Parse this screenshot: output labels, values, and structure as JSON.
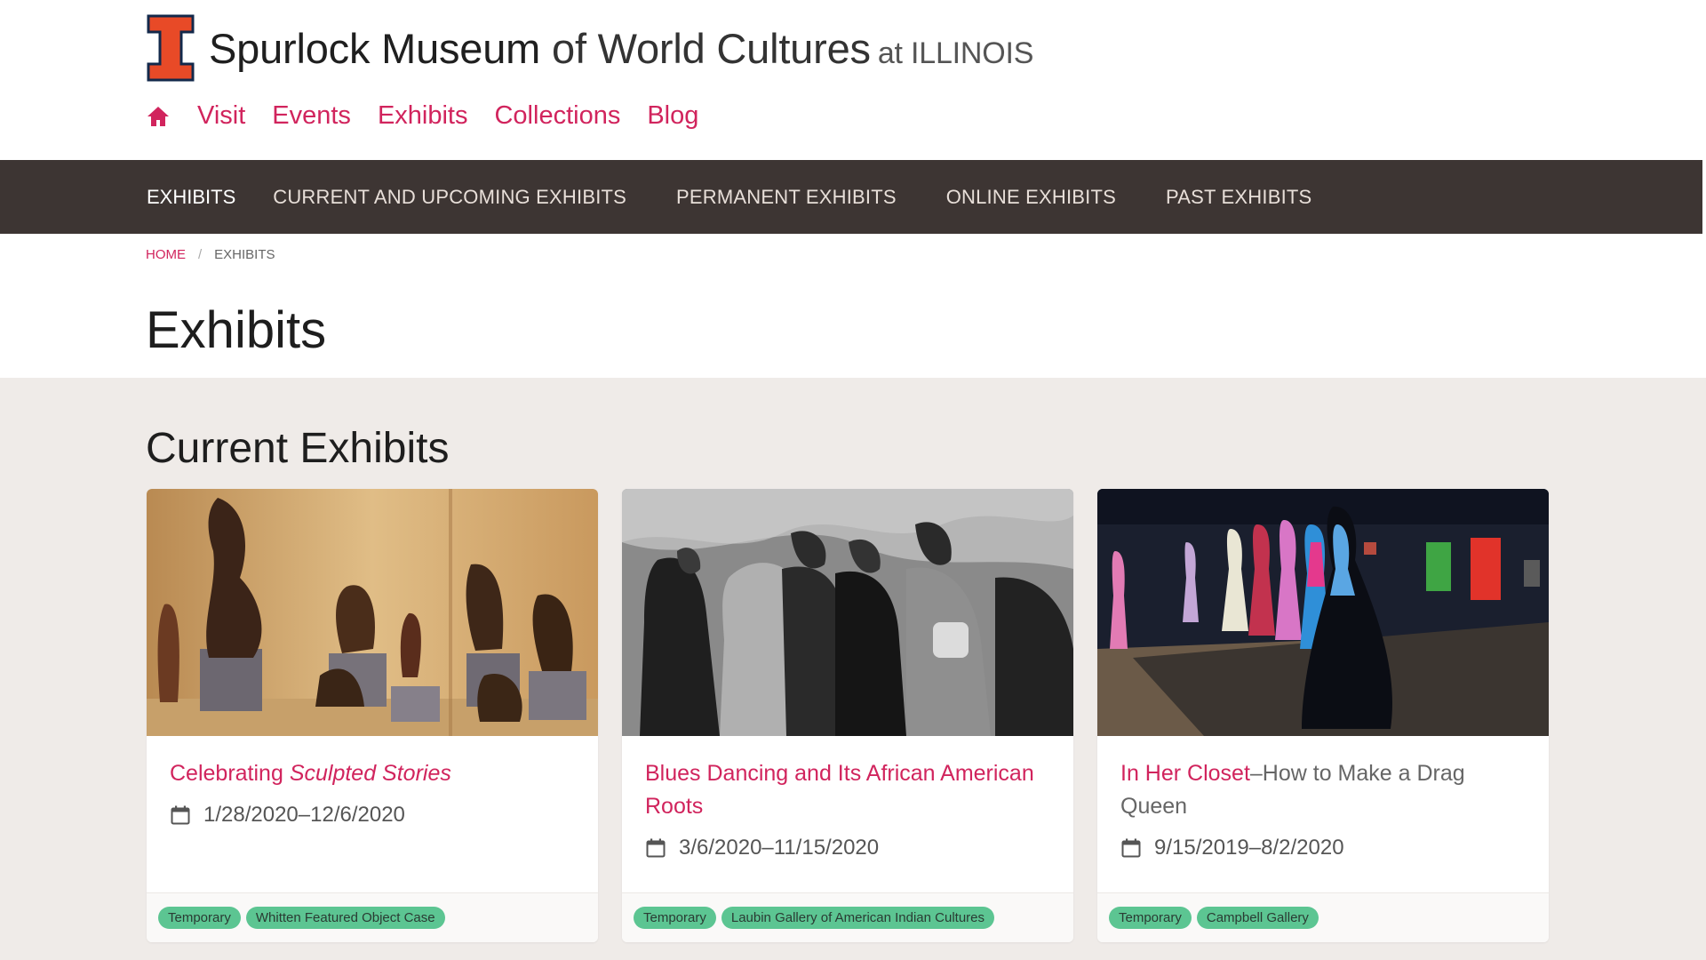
{
  "header": {
    "title_strong": "Spurlock Museum",
    "title_light": " of World Cultures",
    "title_at": "at ILLINOIS",
    "logo_letter": "I"
  },
  "main_nav": {
    "home_icon": "home-icon",
    "items": [
      "Visit",
      "Events",
      "Exhibits",
      "Collections",
      "Blog"
    ]
  },
  "subnav": {
    "title": "EXHIBITS",
    "items": [
      "CURRENT AND UPCOMING EXHIBITS",
      "PERMANENT EXHIBITS",
      "ONLINE EXHIBITS",
      "PAST EXHIBITS"
    ]
  },
  "breadcrumb": {
    "home": "HOME",
    "separator": "/",
    "current": "EXHIBITS"
  },
  "page_title": "Exhibits",
  "section_title": "Current Exhibits",
  "cards": [
    {
      "title_plain": "Celebrating ",
      "title_italic": "Sculpted Stories",
      "title_rest": "",
      "date": "1/28/2020–12/6/2020",
      "tags": [
        "Temporary",
        "Whitten Featured Object Case"
      ]
    },
    {
      "title_plain": "Blues Dancing and Its African American Roots",
      "title_italic": "",
      "title_rest": "",
      "date": "3/6/2020–11/15/2020",
      "tags": [
        "Temporary",
        "Laubin Gallery of American Indian Cultures"
      ]
    },
    {
      "title_plain": "In Her Closet",
      "title_italic": "",
      "title_rest": "–How to Make a Drag Queen",
      "date": "9/15/2019–8/2/2020",
      "tags": [
        "Temporary",
        "Campbell Gallery"
      ]
    }
  ],
  "colors": {
    "brand_orange": "#e84a27",
    "brand_navy": "#13294b",
    "link_red": "#d1245d",
    "subnav_bg": "#3d3533",
    "band_bg": "#efebe8",
    "tag_green": "#5cc592"
  }
}
